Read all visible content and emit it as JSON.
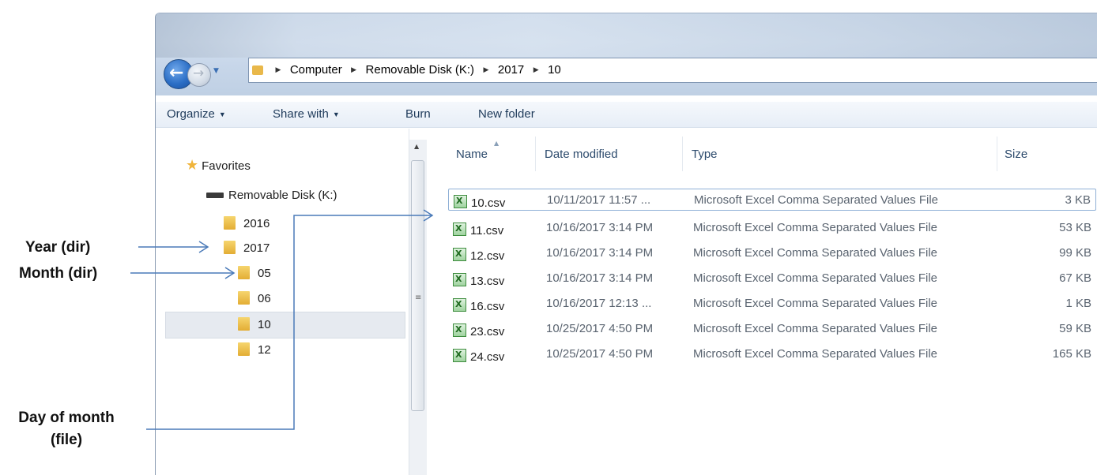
{
  "annotations": {
    "year": "Year (dir)",
    "month": "Month (dir)",
    "day_line1": "Day of month",
    "day_line2": "(file)"
  },
  "address_bar": {
    "crumbs": [
      "Computer",
      "Removable Disk (K:)",
      "2017",
      "10"
    ]
  },
  "toolbar": {
    "organize": "Organize",
    "share_with": "Share with",
    "burn": "Burn",
    "new_folder": "New folder"
  },
  "nav_pane": {
    "favorites": "Favorites",
    "drive": "Removable Disk (K:)",
    "folders": [
      "2016",
      "2017",
      "05",
      "06",
      "10",
      "12"
    ],
    "selected": "10"
  },
  "file_list": {
    "columns": {
      "name": "Name",
      "date": "Date modified",
      "type": "Type",
      "size": "Size"
    },
    "files": [
      {
        "name": "10.csv",
        "date": "10/11/2017 11:57 ...",
        "type": "Microsoft Excel Comma Separated Values File",
        "size": "3 KB"
      },
      {
        "name": "11.csv",
        "date": "10/16/2017 3:14 PM",
        "type": "Microsoft Excel Comma Separated Values File",
        "size": "53 KB"
      },
      {
        "name": "12.csv",
        "date": "10/16/2017 3:14 PM",
        "type": "Microsoft Excel Comma Separated Values File",
        "size": "99 KB"
      },
      {
        "name": "13.csv",
        "date": "10/16/2017 3:14 PM",
        "type": "Microsoft Excel Comma Separated Values File",
        "size": "67 KB"
      },
      {
        "name": "16.csv",
        "date": "10/16/2017 12:13 ...",
        "type": "Microsoft Excel Comma Separated Values File",
        "size": "1 KB"
      },
      {
        "name": "23.csv",
        "date": "10/25/2017 4:50 PM",
        "type": "Microsoft Excel Comma Separated Values File",
        "size": "59 KB"
      },
      {
        "name": "24.csv",
        "date": "10/25/2017 4:50 PM",
        "type": "Microsoft Excel Comma Separated Values File",
        "size": "165 KB"
      }
    ]
  }
}
